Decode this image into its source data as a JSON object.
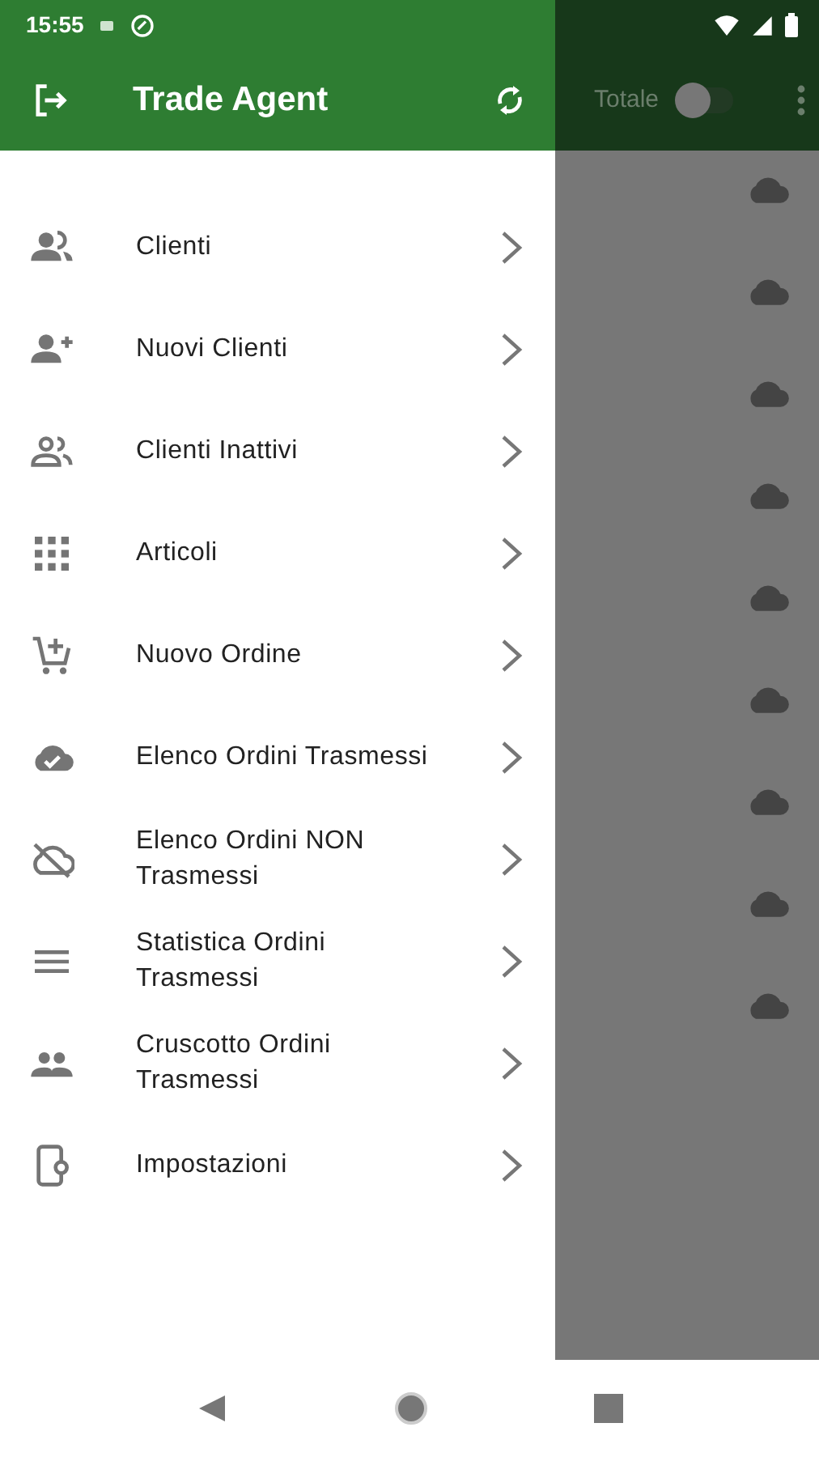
{
  "status_bar": {
    "time": "15:55"
  },
  "drawer": {
    "title": "Trade Agent",
    "items": [
      {
        "label": "Clienti"
      },
      {
        "label": "Nuovi Clienti"
      },
      {
        "label": "Clienti Inattivi"
      },
      {
        "label": "Articoli"
      },
      {
        "label": "Nuovo Ordine"
      },
      {
        "label": "Elenco Ordini Trasmessi"
      },
      {
        "label": "Elenco Ordini NON Trasmessi"
      },
      {
        "label": "Statistica Ordini Trasmessi"
      },
      {
        "label": "Cruscotto Ordini Trasmessi"
      },
      {
        "label": "Impostazioni"
      }
    ]
  },
  "background": {
    "toggle_label": "Totale",
    "toggle_on": false,
    "rows": [
      {
        "kind": "cloud"
      },
      {
        "kind": "cloud"
      },
      {
        "kind": "cloud"
      },
      {
        "kind": "cloud"
      },
      {
        "kind": "cloud"
      },
      {
        "kind": "cloud"
      },
      {
        "kind": "cloud"
      },
      {
        "kind": "cloud"
      },
      {
        "kind": "cloud"
      }
    ]
  }
}
